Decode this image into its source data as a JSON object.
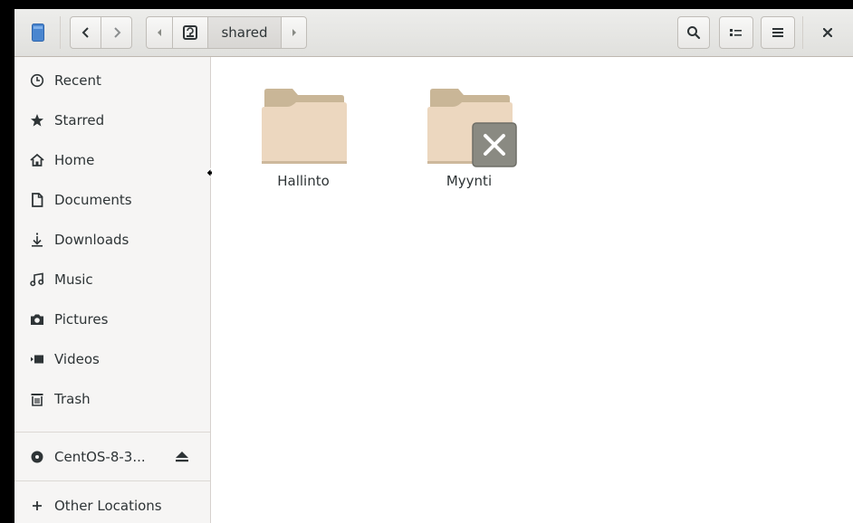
{
  "window": {
    "path_segment": "shared",
    "close_label": "×"
  },
  "sidebar": {
    "places": [
      {
        "label": "Recent",
        "icon": "clock-icon"
      },
      {
        "label": "Starred",
        "icon": "star-icon"
      },
      {
        "label": "Home",
        "icon": "home-icon"
      },
      {
        "label": "Documents",
        "icon": "document-icon"
      },
      {
        "label": "Downloads",
        "icon": "download-icon"
      },
      {
        "label": "Music",
        "icon": "music-icon"
      },
      {
        "label": "Pictures",
        "icon": "camera-icon"
      },
      {
        "label": "Videos",
        "icon": "video-icon"
      },
      {
        "label": "Trash",
        "icon": "trash-icon"
      }
    ],
    "device": {
      "label": "CentOS-8-3...",
      "icon": "disc-icon",
      "action_icon": "eject-icon"
    },
    "other": {
      "label": "Other Locations",
      "icon": "plus-icon"
    }
  },
  "files": [
    {
      "name": "Hallinto",
      "icon": "folder-icon",
      "emblem": ""
    },
    {
      "name": "Myynti",
      "icon": "folder-icon",
      "emblem": "unreadable-emblem-icon"
    }
  ],
  "colors": {
    "folder_back": "#c9b697",
    "folder_front": "#ecd7bf",
    "emblem_bg": "#8a8a82"
  }
}
